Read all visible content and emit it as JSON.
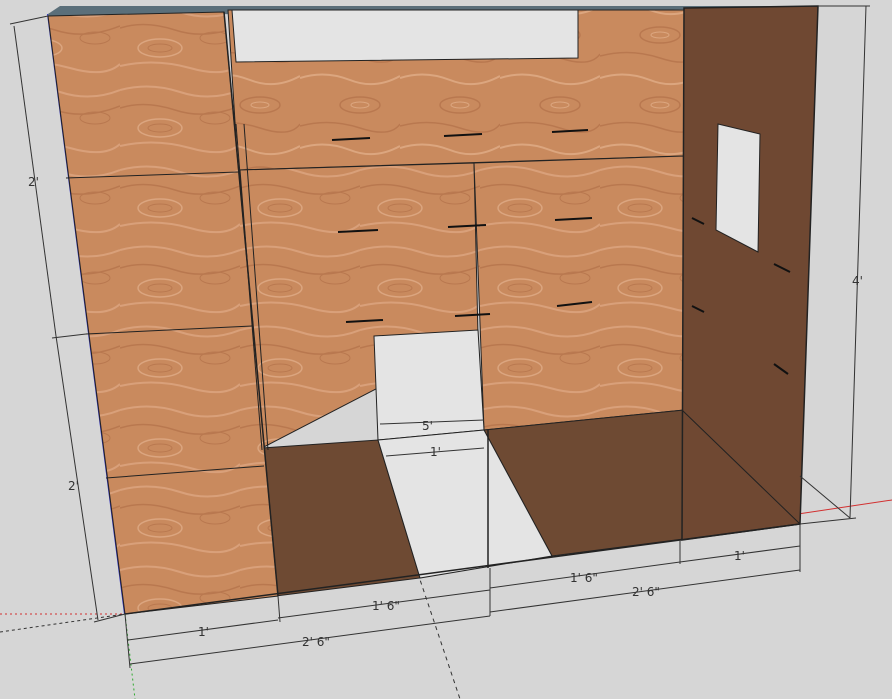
{
  "scene": {
    "background_color": "#d6d6d6",
    "wood_color": "#c98a5e",
    "wood_dark_color": "#b07048",
    "shadow_color": "#6e4a33",
    "side_wall_color": "#6f4832",
    "top_edge_color": "#5b6f7a",
    "opening_color": "#e4e4e4"
  },
  "axes": {
    "red_axis_color": "#d23030",
    "green_axis_color": "#2faa2f",
    "blue_axis_color": "#3a3adc"
  },
  "dimensions": {
    "left_upper": "2'",
    "left_lower": "2'",
    "right_height": "4'",
    "bottom_1ft": "1'",
    "bottom_2ft6": "2' 6\"",
    "bottom_1ft6_a": "1' 6\"",
    "bottom_1ft6_b": "1' 6\"",
    "bottom_2ft6_right": "2' 6\"",
    "bottom_right_1ft": "1'",
    "door_top": "5'",
    "door_floor": "1'"
  }
}
